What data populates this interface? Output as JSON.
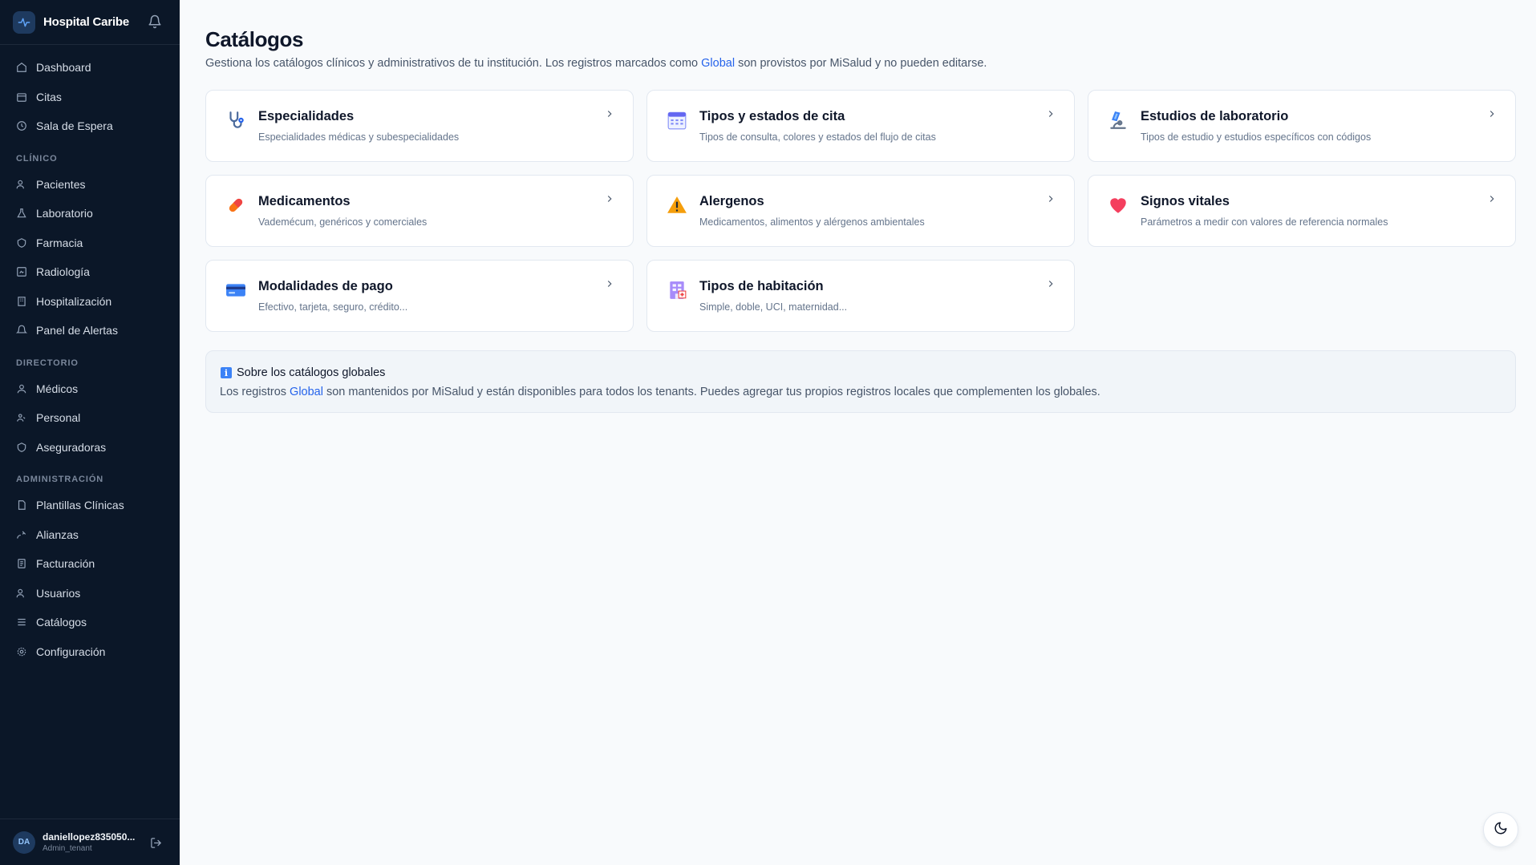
{
  "brand": {
    "name": "Hospital Caribe"
  },
  "nav": {
    "top": [
      {
        "id": "dashboard",
        "label": "Dashboard",
        "icon": "home-icon"
      },
      {
        "id": "citas",
        "label": "Citas",
        "icon": "calendar-icon"
      },
      {
        "id": "sala",
        "label": "Sala de Espera",
        "icon": "clock-icon"
      }
    ],
    "sections": [
      {
        "title": "CLÍNICO",
        "items": [
          {
            "id": "pacientes",
            "label": "Pacientes",
            "icon": "users-icon"
          },
          {
            "id": "laboratorio",
            "label": "Laboratorio",
            "icon": "flask-icon"
          },
          {
            "id": "farmacia",
            "label": "Farmacia",
            "icon": "pill-icon"
          },
          {
            "id": "radiologia",
            "label": "Radiología",
            "icon": "scan-icon"
          },
          {
            "id": "hospitalizacion",
            "label": "Hospitalización",
            "icon": "building-icon"
          },
          {
            "id": "alertas",
            "label": "Panel de Alertas",
            "icon": "bell-icon"
          }
        ]
      },
      {
        "title": "DIRECTORIO",
        "items": [
          {
            "id": "medicos",
            "label": "Médicos",
            "icon": "user-icon"
          },
          {
            "id": "personal",
            "label": "Personal",
            "icon": "user-group-icon"
          },
          {
            "id": "aseguradoras",
            "label": "Aseguradoras",
            "icon": "shield-icon"
          }
        ]
      },
      {
        "title": "ADMINISTRACIÓN",
        "items": [
          {
            "id": "plantillas",
            "label": "Plantillas Clínicas",
            "icon": "file-icon"
          },
          {
            "id": "alianzas",
            "label": "Alianzas",
            "icon": "handshake-icon"
          },
          {
            "id": "facturacion",
            "label": "Facturación",
            "icon": "receipt-icon"
          },
          {
            "id": "usuarios",
            "label": "Usuarios",
            "icon": "users-icon"
          },
          {
            "id": "catalogos",
            "label": "Catálogos",
            "icon": "list-icon"
          },
          {
            "id": "configuracion",
            "label": "Configuración",
            "icon": "gear-icon"
          }
        ]
      }
    ]
  },
  "user": {
    "initials": "DA",
    "name": "daniellopez835050...",
    "role": "Admin_tenant"
  },
  "page": {
    "title": "Catálogos",
    "subtitle_before": "Gestiona los catálogos clínicos y administrativos de tu institución. Los registros marcados como ",
    "subtitle_link": "Global",
    "subtitle_after": " son provistos por MiSalud y no pueden editarse."
  },
  "cards": [
    {
      "title": "Especialidades",
      "desc": "Especialidades médicas y subespecialidades",
      "icon": "stethoscope-icon"
    },
    {
      "title": "Tipos y estados de cita",
      "desc": "Tipos de consulta, colores y estados del flujo de citas",
      "icon": "calendar-icon"
    },
    {
      "title": "Estudios de laboratorio",
      "desc": "Tipos de estudio y estudios específicos con códigos",
      "icon": "microscope-icon"
    },
    {
      "title": "Medicamentos",
      "desc": "Vademécum, genéricos y comerciales",
      "icon": "pill-icon"
    },
    {
      "title": "Alergenos",
      "desc": "Medicamentos, alimentos y alérgenos ambientales",
      "icon": "warning-icon"
    },
    {
      "title": "Signos vitales",
      "desc": "Parámetros a medir con valores de referencia normales",
      "icon": "heart-icon"
    },
    {
      "title": "Modalidades de pago",
      "desc": "Efectivo, tarjeta, seguro, crédito...",
      "icon": "credit-card-icon"
    },
    {
      "title": "Tipos de habitación",
      "desc": "Simple, doble, UCI, maternidad...",
      "icon": "hospital-bed-icon"
    }
  ],
  "info": {
    "badge": "i",
    "title": "Sobre los catálogos globales",
    "text_before": "Los registros ",
    "text_link": "Global",
    "text_after": " son mantenidos por MiSalud y están disponibles para todos los tenants. Puedes agregar tus propios registros locales que complementen los globales."
  },
  "colors": {
    "sidebar_bg": "#0b1728",
    "accent": "#2563eb",
    "page_bg": "#f8fafc"
  }
}
